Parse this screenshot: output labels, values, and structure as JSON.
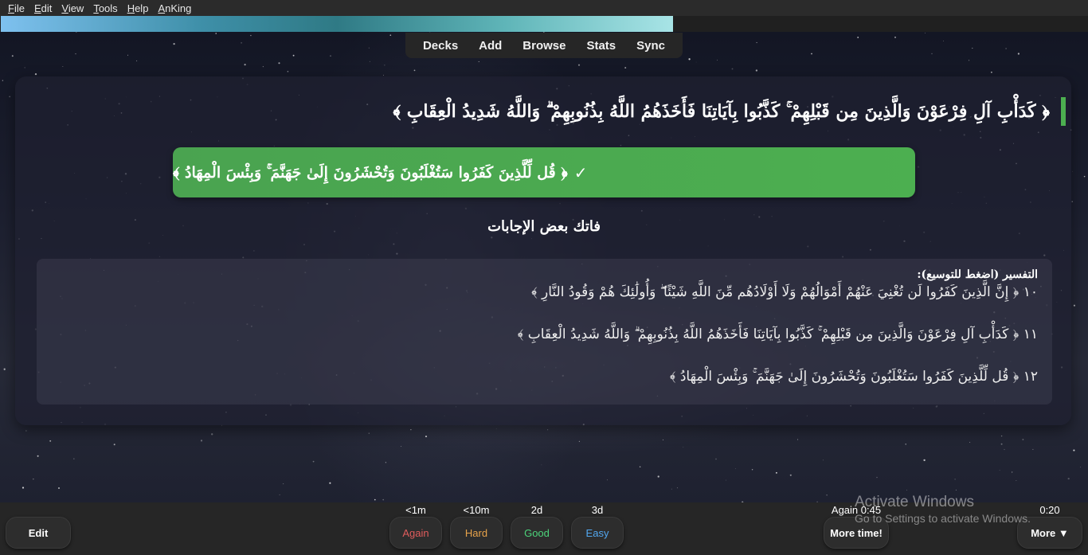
{
  "menu": {
    "items": [
      {
        "u": "F",
        "rest": "ile"
      },
      {
        "u": "E",
        "rest": "dit"
      },
      {
        "u": "V",
        "rest": "iew"
      },
      {
        "u": "T",
        "rest": "ools"
      },
      {
        "u": "H",
        "rest": "elp"
      },
      {
        "u": "A",
        "rest": "nKing"
      }
    ]
  },
  "progress": {
    "fraction": 0.618
  },
  "toolbar": {
    "decks": "Decks",
    "add": "Add",
    "browse": "Browse",
    "stats": "Stats",
    "sync": "Sync"
  },
  "card": {
    "question": "﴿ كَدَأْبِ آلِ فِرْعَوْنَ وَالَّذِينَ مِن قَبْلِهِمْ ۚ كَذَّبُوا بِآيَاتِنَا فَأَخَذَهُمُ اللَّهُ بِذُنُوبِهِمْ ۗ وَاللَّهُ شَدِيدُ الْعِقَابِ ﴾",
    "answer_check": "✓",
    "answer": "﴿ قُل لِّلَّذِينَ كَفَرُوا سَتُغْلَبُونَ وَتُحْشَرُونَ إِلَىٰ جَهَنَّمَ ۚ وَبِئْسَ الْمِهَادُ ﴾",
    "missed_note": "فاتك بعض الإجابات",
    "tafsir_title": "التفسير (اضغط للتوسيع):",
    "ayat": [
      "١٠ ﴿ إِنَّ الَّذِينَ كَفَرُوا لَن تُغْنِيَ عَنْهُمْ أَمْوَالُهُمْ وَلَا أَوْلَادُهُم مِّنَ اللَّهِ شَيْئًا ۖ وَأُولَٰئِكَ هُمْ وَقُودُ النَّارِ ﴾",
      "١١ ﴿ كَدَأْبِ آلِ فِرْعَوْنَ وَالَّذِينَ مِن قَبْلِهِمْ ۚ كَذَّبُوا بِآيَاتِنَا فَأَخَذَهُمُ اللَّهُ بِذُنُوبِهِمْ ۗ وَاللَّهُ شَدِيدُ الْعِقَابِ ﴾",
      "١٢ ﴿ قُل لِّلَّذِينَ كَفَرُوا سَتُغْلَبُونَ وَتُحْشَرُونَ إِلَىٰ جَهَنَّمَ ۚ وَبِئْسَ الْمِهَادُ ﴾"
    ]
  },
  "bottom": {
    "edit": "Edit",
    "intervals": {
      "again": "<1m",
      "hard": "<10m",
      "good": "2d",
      "easy": "3d"
    },
    "again": "Again",
    "hard": "Hard",
    "good": "Good",
    "easy": "Easy",
    "again_timer": "Again 0:45",
    "more_time": "More time!",
    "elapsed": "0:20",
    "more": "More ▼",
    "colors": {
      "again": "#e05c5c",
      "hard": "#e8a34a",
      "good": "#4cd37a",
      "easy": "#52a7ef"
    }
  },
  "watermark": {
    "line1": "Activate Windows",
    "line2": "Go to Settings to activate Windows."
  }
}
